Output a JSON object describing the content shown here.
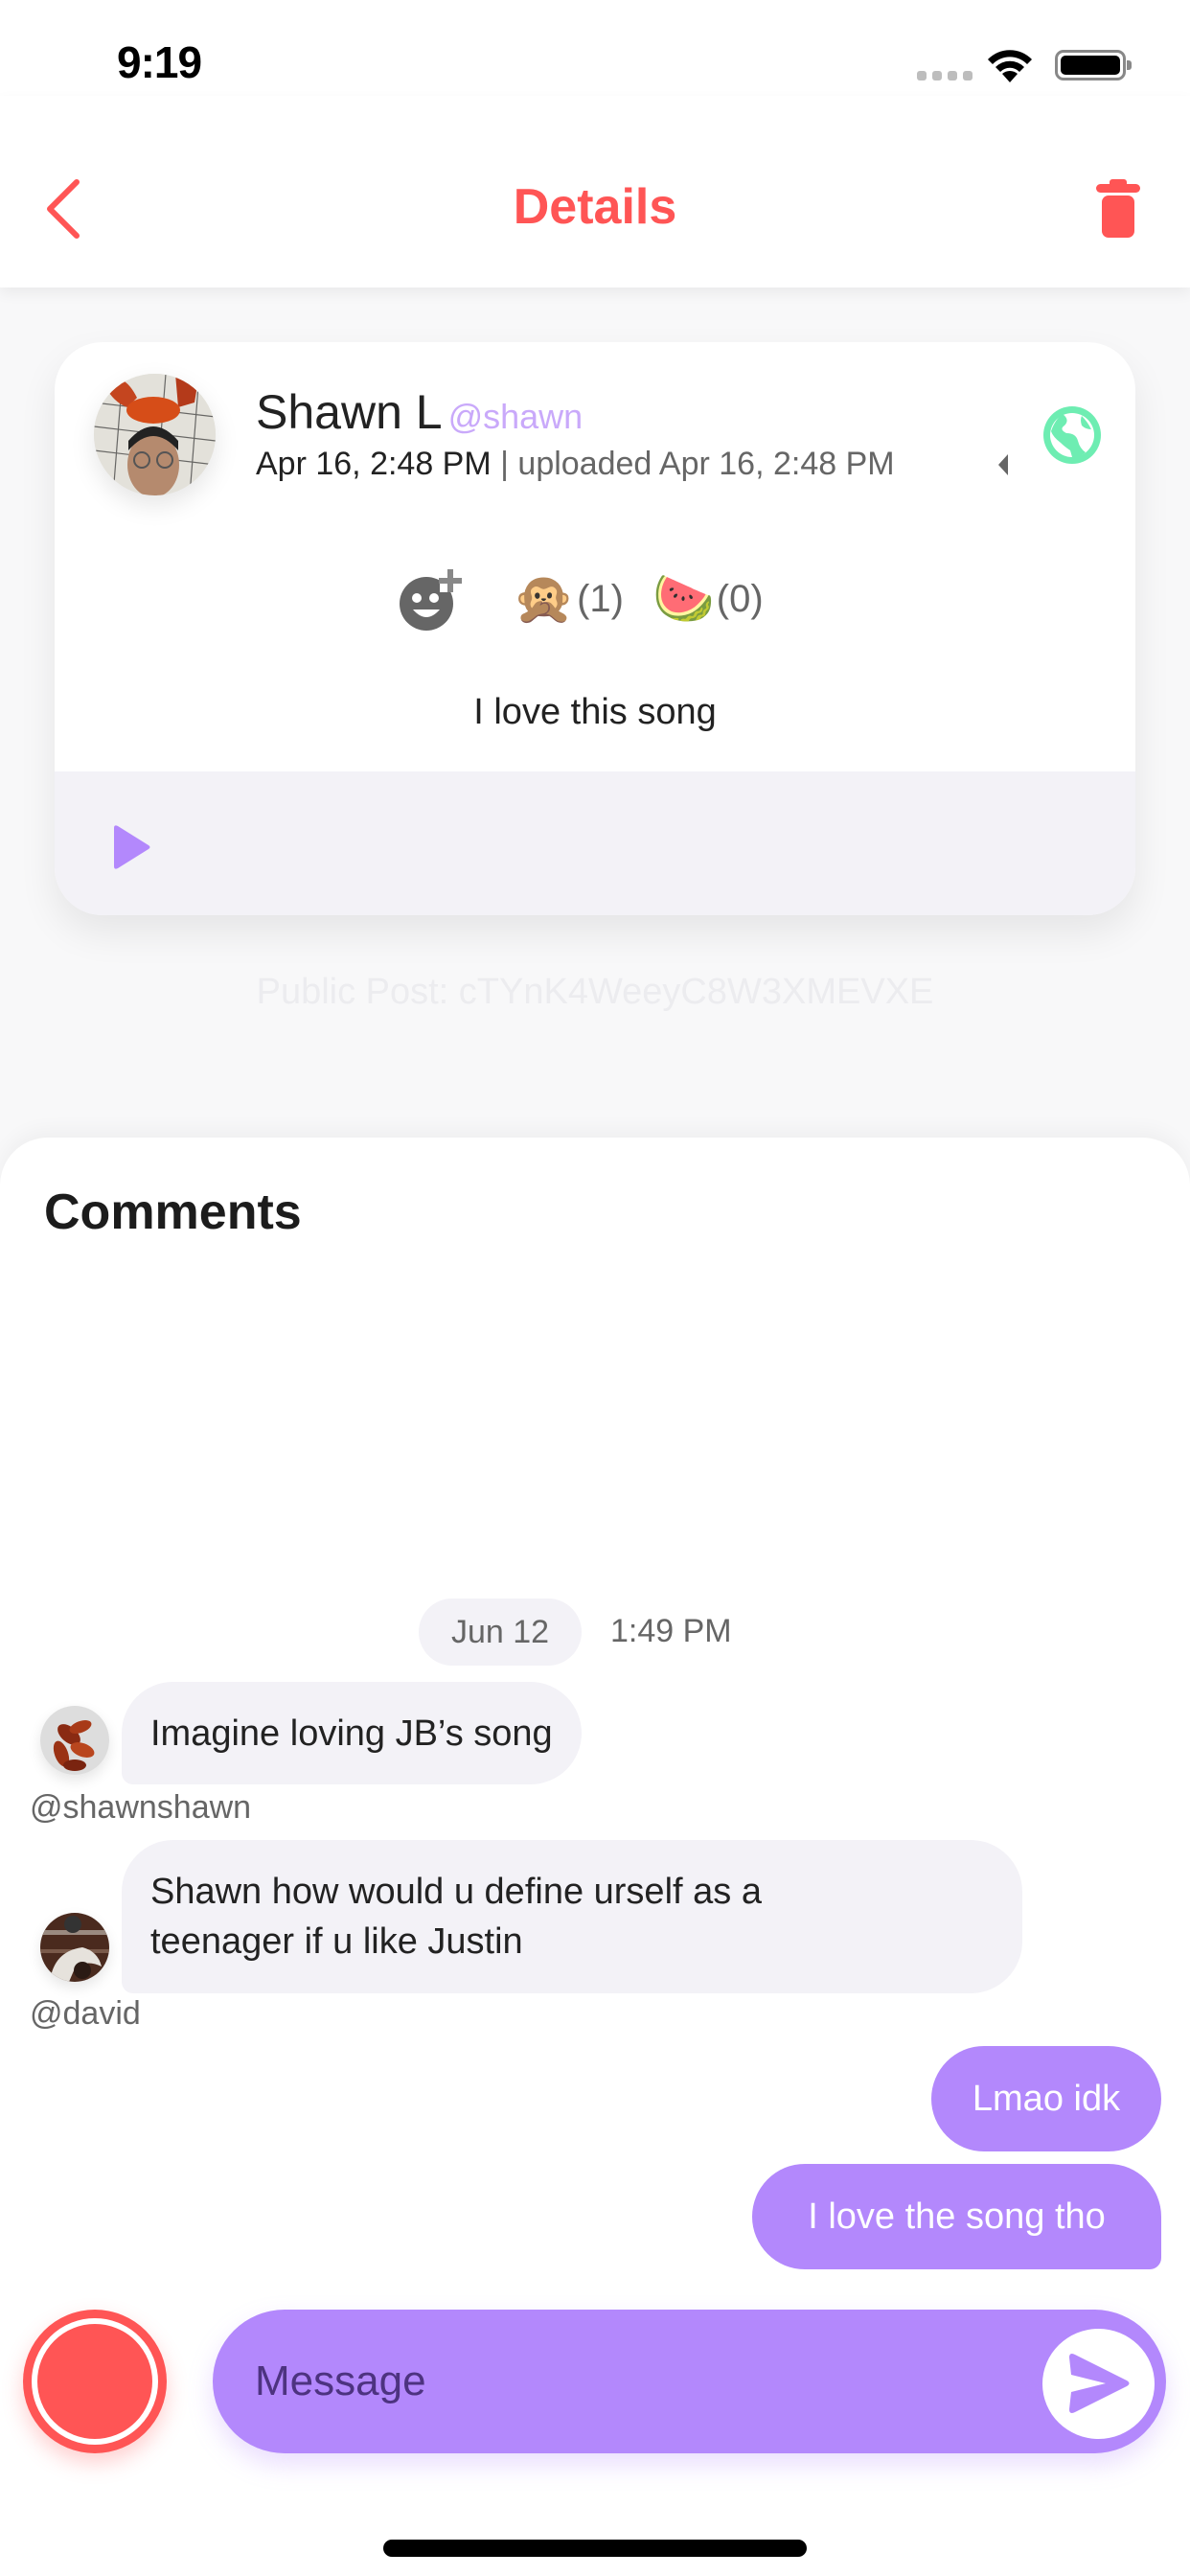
{
  "status_bar": {
    "time": "9:19"
  },
  "header": {
    "title": "Details",
    "back_icon": "chevron-left-icon",
    "delete_icon": "trash-icon"
  },
  "post": {
    "author_name": "Shawn L",
    "author_handle": "@shawn",
    "created": "Apr 16, 2:48 PM",
    "separator": " | ",
    "uploaded": "uploaded Apr 16, 2:48 PM",
    "visibility_icon": "globe-icon",
    "reactions": [
      {
        "emoji": "🙊",
        "count": "(1)"
      },
      {
        "emoji": "🍉",
        "count": "(0)"
      }
    ],
    "caption": "I love this song",
    "player_icon": "play-icon",
    "post_id_label": "Public Post: cTYnK4WeeyC8W3XMEVXE"
  },
  "comments": {
    "title": "Comments",
    "date": "Jun 12",
    "time": "1:49 PM",
    "messages": [
      {
        "direction": "in",
        "text": "Imagine loving JB’s song",
        "handle": "@shawnshawn"
      },
      {
        "direction": "in",
        "text": "Shawn how would u define urself as a teenager if u like Justin",
        "handle": "@david"
      },
      {
        "direction": "out",
        "text": "Lmao idk"
      },
      {
        "direction": "out",
        "text": "I love the song tho"
      }
    ]
  },
  "composer": {
    "placeholder": "Message",
    "value": ""
  },
  "colors": {
    "accent_red": "#FF5555",
    "accent_purple": "#B388FC",
    "handle_purple": "#C9A9FA",
    "globe_green": "#6EEDB2",
    "bubble_grey": "#F3F2F7"
  }
}
